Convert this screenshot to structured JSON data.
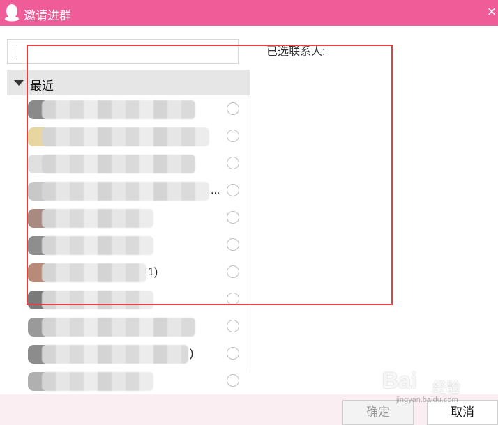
{
  "window": {
    "title": "邀请进群",
    "close_glyph": "×",
    "icon": "qq-penguin-icon",
    "title_bar_color": "#ef5c98"
  },
  "search": {
    "value": "",
    "placeholder": ""
  },
  "group": {
    "label": "最近",
    "arrow_icon": "triangle-down-icon"
  },
  "contacts": [
    {
      "name": "",
      "suffix": "",
      "avatar_color": "#8a8a8a",
      "blur_width": 220
    },
    {
      "name": "",
      "suffix": "",
      "avatar_color": "#e8d6a0",
      "blur_width": 240
    },
    {
      "name": "",
      "suffix": "",
      "avatar_color": "#e0e0e0",
      "blur_width": 220
    },
    {
      "name": "",
      "suffix": "...",
      "avatar_color": "#c8c8c8",
      "blur_width": 240
    },
    {
      "name": "",
      "suffix": "",
      "avatar_color": "#a88a80",
      "blur_width": 160
    },
    {
      "name": "",
      "suffix": "",
      "avatar_color": "#8e8e8e",
      "blur_width": 160
    },
    {
      "name": "",
      "suffix": "1)",
      "avatar_color": "#b98a78",
      "blur_width": 150
    },
    {
      "name": "",
      "suffix": "",
      "avatar_color": "#7a7a7a",
      "blur_width": 160
    },
    {
      "name": "",
      "suffix": "",
      "avatar_color": "#9a9a9a",
      "blur_width": 220
    },
    {
      "name": "",
      "suffix": ")",
      "avatar_color": "#8c8c8c",
      "blur_width": 210
    },
    {
      "name": "",
      "suffix": "",
      "avatar_color": "#b0b0b0",
      "blur_width": 160
    }
  ],
  "right_panel": {
    "label": "已选联系人:"
  },
  "buttons": {
    "ok": "确定",
    "cancel": "取消"
  },
  "annotation": {
    "color": "#e63f3f"
  },
  "watermark": {
    "brand": "Bai",
    "sub": "经验",
    "url": "jingyan.baidu.com"
  }
}
